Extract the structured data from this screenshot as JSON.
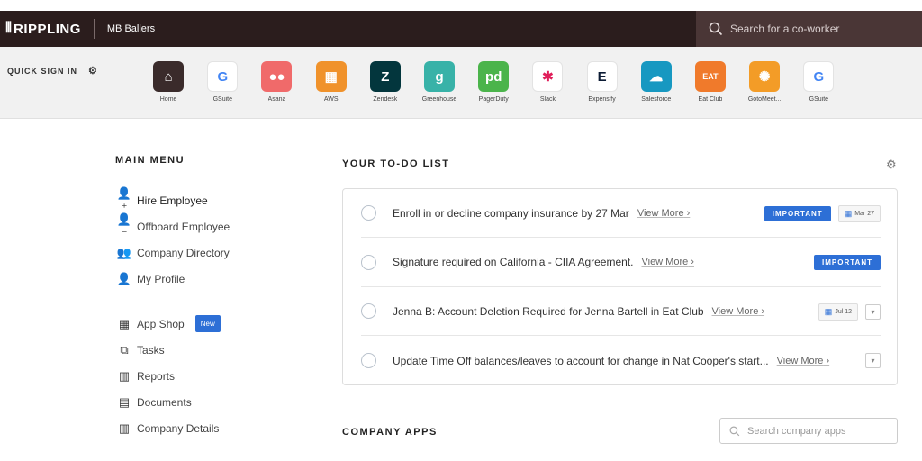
{
  "header": {
    "brand": "RIPPLING",
    "company": "MB Ballers",
    "search_placeholder": "Search for a co-worker"
  },
  "quick_sign_in": {
    "label": "QUICK SIGN IN",
    "apps": [
      {
        "name": "Home",
        "glyph": "⌂",
        "color": "#3a2b2b",
        "icon": "home-icon"
      },
      {
        "name": "GSuite",
        "glyph": "G",
        "color": "#ffffff",
        "fg": "#4285f4",
        "icon": "google-icon"
      },
      {
        "name": "Asana",
        "glyph": "●●",
        "color": "#f06a6a",
        "icon": "asana-icon"
      },
      {
        "name": "AWS",
        "glyph": "▦",
        "color": "#f0922b",
        "icon": "aws-icon"
      },
      {
        "name": "Zendesk",
        "glyph": "Z",
        "color": "#03363d",
        "icon": "zendesk-icon"
      },
      {
        "name": "Greenhouse",
        "glyph": "g",
        "color": "#38b2a8",
        "icon": "greenhouse-icon"
      },
      {
        "name": "PagerDuty",
        "glyph": "pd",
        "color": "#4bb44b",
        "icon": "pagerduty-icon"
      },
      {
        "name": "Slack",
        "glyph": "✱",
        "color": "#ffffff",
        "fg": "#e01e5a",
        "icon": "slack-icon"
      },
      {
        "name": "Expensify",
        "glyph": "E",
        "color": "#ffffff",
        "fg": "#0b1b34",
        "icon": "expensify-icon"
      },
      {
        "name": "Salesforce",
        "glyph": "☁",
        "color": "#1798c1",
        "icon": "salesforce-icon"
      },
      {
        "name": "Eat Club",
        "glyph": "EAT",
        "color": "#f07a2b",
        "icon": "eatclub-icon"
      },
      {
        "name": "GotoMeet...",
        "glyph": "✺",
        "color": "#f39c27",
        "icon": "gotomeeting-icon"
      },
      {
        "name": "GSuite",
        "glyph": "G",
        "color": "#ffffff",
        "fg": "#4285f4",
        "icon": "google-icon"
      }
    ]
  },
  "main_menu": {
    "title": "MAIN MENU",
    "group1": [
      {
        "label": "Hire Employee",
        "icon": "person-add-icon",
        "glyph": "👤⁺"
      },
      {
        "label": "Offboard Employee",
        "icon": "person-remove-icon",
        "glyph": "👤⁻"
      },
      {
        "label": "Company Directory",
        "icon": "people-icon",
        "glyph": "👥"
      },
      {
        "label": "My Profile",
        "icon": "person-icon",
        "glyph": "👤"
      }
    ],
    "group2": [
      {
        "label": "App Shop",
        "icon": "grid-icon",
        "glyph": "▦",
        "badge": "New"
      },
      {
        "label": "Tasks",
        "icon": "tasks-icon",
        "glyph": "⧉"
      },
      {
        "label": "Reports",
        "icon": "reports-icon",
        "glyph": "▥"
      },
      {
        "label": "Documents",
        "icon": "document-icon",
        "glyph": "▤"
      },
      {
        "label": "Company Details",
        "icon": "building-icon",
        "glyph": "▥"
      }
    ]
  },
  "todo": {
    "title": "YOUR TO-DO LIST",
    "items": [
      {
        "text": "Enroll in or decline company insurance by 27 Mar",
        "view_more": "View More",
        "important": "IMPORTANT",
        "date": "Mar 27"
      },
      {
        "text": "Signature required on California - CIIA Agreement.",
        "view_more": "View More",
        "important": "IMPORTANT"
      },
      {
        "text": "Jenna B: Account Deletion Required for Jenna Bartell in Eat Club",
        "view_more": "View More",
        "date": "Jul 12"
      },
      {
        "text": "Update Time Off balances/leaves to account for change in Nat Cooper's start...",
        "view_more": "View More"
      }
    ]
  },
  "company_apps": {
    "title": "COMPANY APPS",
    "search_placeholder": "Search company apps"
  }
}
